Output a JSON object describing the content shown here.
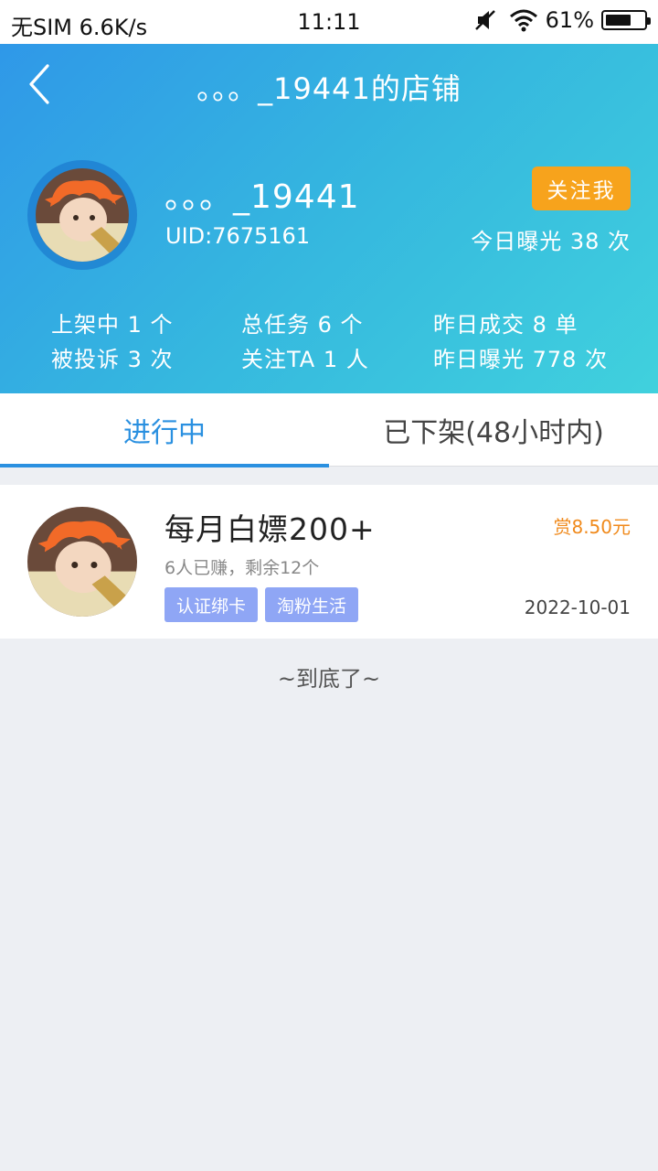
{
  "status_bar": {
    "carrier": "无SIM 6.6K/s",
    "time": "11:11",
    "battery": "61%",
    "battery_level": 0.61
  },
  "header": {
    "title": "。。。_19441的店铺",
    "shop_name": "。。。_19441",
    "uid": "UID:7675161",
    "follow_label": "关注我",
    "exposure_today": "今日曝光 38 次",
    "stats": {
      "listed": "上架中 1 个",
      "complaints": "被投诉 3 次",
      "total_tasks": "总任务 6 个",
      "followers": "关注TA 1 人",
      "deals_yesterday": "昨日成交 8 单",
      "exposure_yesterday": "昨日曝光 778 次"
    }
  },
  "tabs": {
    "active": "进行中",
    "inactive": "已下架(48小时内)"
  },
  "task": {
    "title": "每月白嫖200+",
    "reward": "赏8.50元",
    "progress": "6人已赚，剩余12个",
    "tags": [
      "认证绑卡",
      "淘粉生活"
    ],
    "date": "2022-10-01"
  },
  "footer": {
    "end_text": "~到底了~"
  },
  "colors": {
    "header_gradient_start": "#2f98e8",
    "header_gradient_end": "#40d1dd",
    "follow_button": "#f7a31c",
    "active_tab": "#2a90e0",
    "reward": "#f08a1c",
    "tag": "#8fa6f5"
  }
}
